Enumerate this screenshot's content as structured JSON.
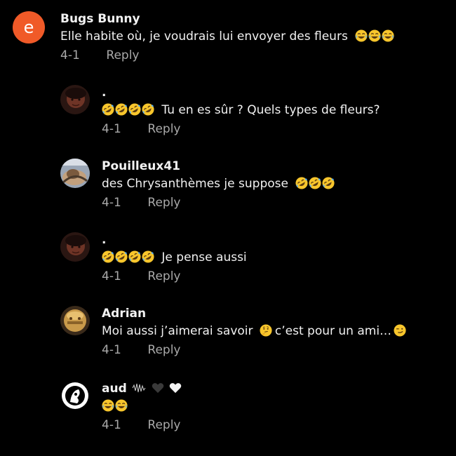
{
  "comments": [
    {
      "username": "Bugs Bunny",
      "avatar_letter": "e",
      "avatar_color": "#f05a28",
      "text": "Elle habite où, je voudrais lui envoyer des fleurs",
      "trailing_emojis": [
        "face-with-tears-of-joy",
        "face-with-tears-of-joy",
        "face-with-tears-of-joy"
      ],
      "date": "4-1",
      "reply_label": "Reply"
    },
    {
      "username": ".",
      "leading_emojis": [
        "rolling-on-floor-laughing",
        "rolling-on-floor-laughing",
        "rolling-on-floor-laughing",
        "rolling-on-floor-laughing"
      ],
      "text": "Tu en es sûr ? Quels types de fleurs?",
      "date": "4-1",
      "reply_label": "Reply"
    },
    {
      "username": "Pouilleux41",
      "text": "des Chrysanthèmes je suppose",
      "trailing_emojis": [
        "rolling-on-floor-laughing",
        "rolling-on-floor-laughing",
        "rolling-on-floor-laughing"
      ],
      "date": "4-1",
      "reply_label": "Reply"
    },
    {
      "username": ".",
      "leading_emojis": [
        "rolling-on-floor-laughing",
        "rolling-on-floor-laughing",
        "rolling-on-floor-laughing",
        "rolling-on-floor-laughing"
      ],
      "text": "Je pense aussi",
      "date": "4-1",
      "reply_label": "Reply"
    },
    {
      "username": "Adrian",
      "text_before": "Moi aussi j’aimerai savoir",
      "middle_emoji": "thinking-face",
      "text_after": "c’est pour un ami…",
      "trailing_emojis": [
        "smirking-face"
      ],
      "date": "4-1",
      "reply_label": "Reply"
    },
    {
      "username": "aud",
      "username_decorations": [
        "waveform-glyph",
        "black-heart",
        "white-heart"
      ],
      "text_emojis": [
        "face-with-tears-of-joy",
        "face-with-tears-of-joy"
      ],
      "date": "4-1",
      "reply_label": "Reply"
    }
  ]
}
